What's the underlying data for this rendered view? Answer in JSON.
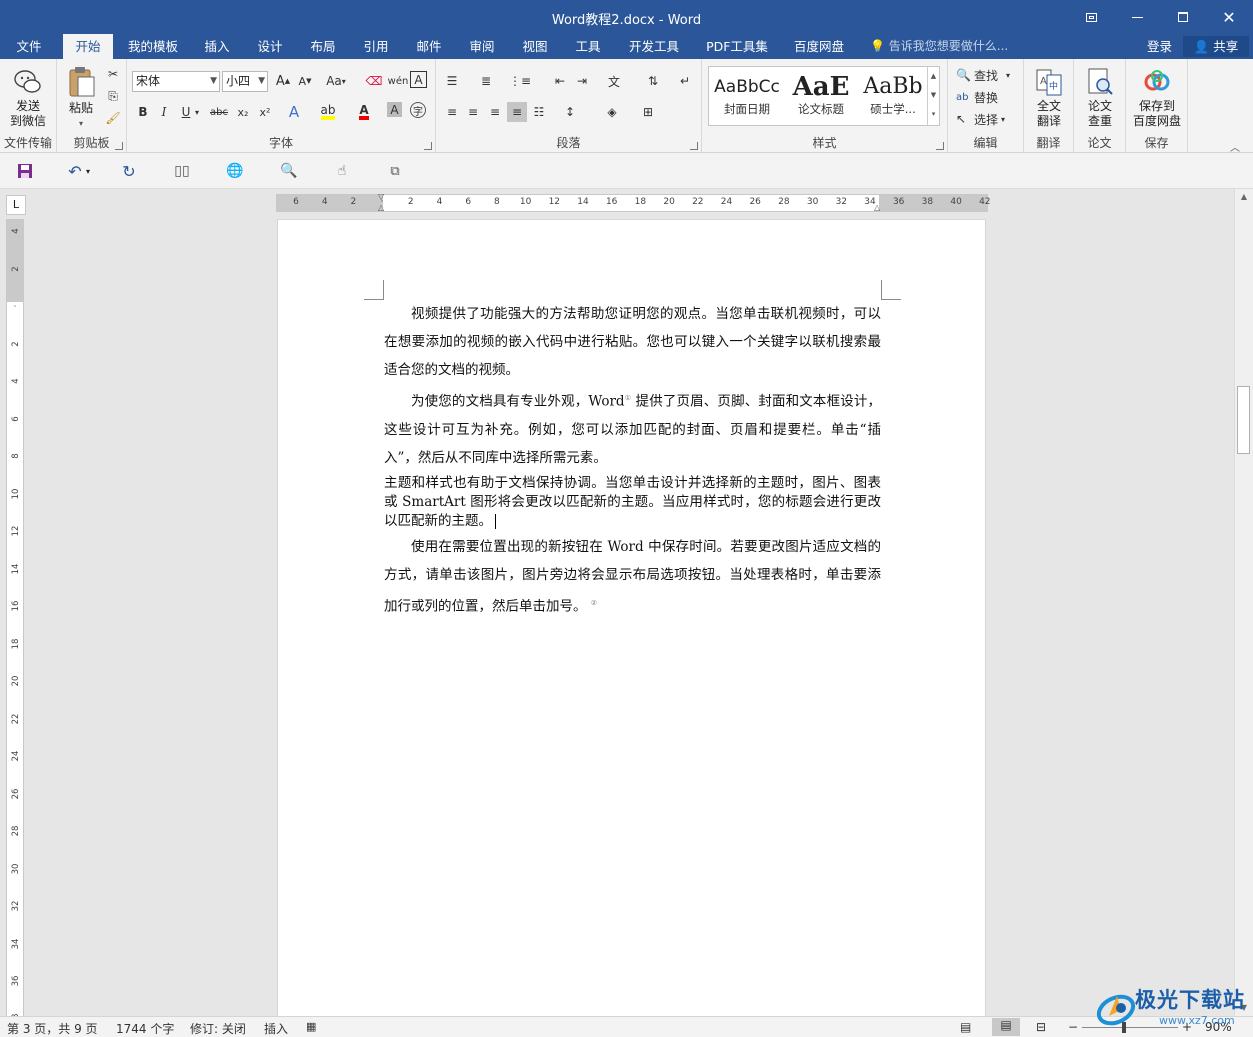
{
  "window": {
    "title": "Word教程2.docx - Word",
    "buttons": [
      "restore-ribbon",
      "minimize",
      "maximize",
      "close"
    ]
  },
  "tabs": [
    {
      "label": "文件"
    },
    {
      "label": "开始"
    },
    {
      "label": "我的模板"
    },
    {
      "label": "插入"
    },
    {
      "label": "设计"
    },
    {
      "label": "布局"
    },
    {
      "label": "引用"
    },
    {
      "label": "邮件"
    },
    {
      "label": "审阅"
    },
    {
      "label": "视图"
    },
    {
      "label": "工具"
    },
    {
      "label": "开发工具"
    },
    {
      "label": "PDF工具集"
    },
    {
      "label": "百度网盘"
    }
  ],
  "active_tab": "开始",
  "tellme": "告诉我您想要做什么...",
  "account": {
    "login": "登录",
    "share": "共享"
  },
  "ribbon": {
    "file_transfer": {
      "button": "发送\n到微信",
      "label": "文件传输"
    },
    "clipboard": {
      "paste": "粘贴",
      "label": "剪贴板"
    },
    "font": {
      "name": "宋体",
      "size": "小四",
      "case": "Aa",
      "label": "字体"
    },
    "paragraph": {
      "label": "段落"
    },
    "styles": {
      "items": [
        {
          "sample": "AaBbCc",
          "name": "封面日期"
        },
        {
          "sample": "AaE",
          "name": "论文标题"
        },
        {
          "sample": "AaBb",
          "name": "硕士学..."
        }
      ],
      "label": "样式"
    },
    "editing": {
      "find": "查找",
      "replace": "替换",
      "select": "选择",
      "label": "编辑"
    },
    "translate": {
      "button": "全文\n翻译",
      "label": "翻译"
    },
    "paper": {
      "button": "论文\n查重",
      "label": "论文"
    },
    "save": {
      "button": "保存到\n百度网盘",
      "label": "保存"
    }
  },
  "ruler": {
    "h_ticks": [
      "6",
      "4",
      "2",
      "",
      "2",
      "4",
      "6",
      "8",
      "10",
      "12",
      "14",
      "16",
      "18",
      "20",
      "22",
      "24",
      "26",
      "28",
      "30",
      "32",
      "34",
      "36",
      "38",
      "40",
      "42"
    ],
    "v_ticks": [
      "4",
      "2",
      "",
      "2",
      "4",
      "6",
      "8",
      "10",
      "12",
      "14",
      "16",
      "18",
      "20",
      "22",
      "24",
      "26",
      "28",
      "30",
      "32",
      "34",
      "36",
      "38"
    ]
  },
  "document": {
    "paragraphs": [
      {
        "text": "视频提供了功能强大的方法帮助您证明您的观点。当您单击联机视频时，可以在想要添加的视频的嵌入代码中进行粘贴。您也可以键入一个关键字以联机搜索最适合您的文档的视频。"
      },
      {
        "text_a": "为使您的文档具有专业外观，Word",
        "note": "①",
        "text_b": " 提供了页眉、页脚、封面和文本框设计，这些设计可互为补充。例如，您可以添加匹配的封面、页眉和提要栏。单击“插入”，然后从不同库中选择所需元素。"
      },
      {
        "text": "主题和样式也有助于文档保持协调。当您单击设计并选择新的主题时，图片、图表或 SmartArt 图形将会更改以匹配新的主题。当应用样式时，您的标题会进行更改以匹配新的主题。"
      },
      {
        "text": "使用在需要位置出现的新按钮在 Word 中保存时间。若要更改图片适应文档的方式，请单击该图片，图片旁边将会显示布局选项按钮。当处理表格时，单击要添加行或列的位置，然后单击加号。",
        "note": "②"
      }
    ]
  },
  "status": {
    "page": "第 3 页，共 9 页",
    "words": "1744 个字",
    "track": "修订: 关闭",
    "mode": "插入",
    "zoom": "90%"
  },
  "watermark": {
    "title": "极光下载站",
    "url": "www.xz7.com"
  }
}
